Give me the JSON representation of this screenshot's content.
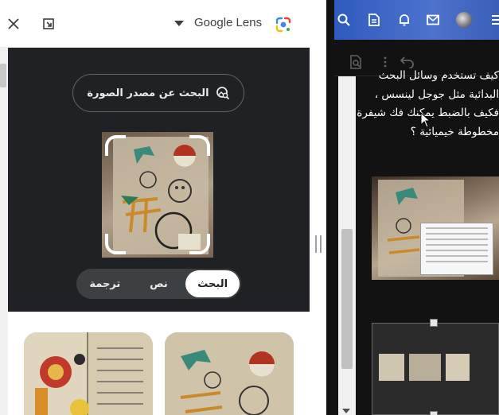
{
  "lens": {
    "title": "Google Lens",
    "source_button": "البحث عن مصدر الصورة",
    "tabs": [
      {
        "label": "البحث",
        "active": true
      },
      {
        "label": "نص",
        "active": false
      },
      {
        "label": "ترجمة",
        "active": false
      }
    ],
    "icons": {
      "close": "close-icon",
      "open_new": "open-in-new-icon",
      "menu": "caret-down-icon",
      "logo": "lens-logo-icon"
    },
    "accent_colors": {
      "blue": "#4285f4",
      "red": "#ea4335",
      "yellow": "#fbbc04",
      "green": "#34a853"
    }
  },
  "article": {
    "lines": [
      "كيف تستخدم وسائل البحث",
      "البدائية مثل جوجل لينسس ،",
      "فكيف بالضبط يمكنك فك شيفرة",
      "مخطوطة خيميائية ؟"
    ]
  },
  "blog_bar": {
    "icons": [
      "search-icon",
      "document-icon",
      "bell-icon",
      "mail-icon",
      "avatar",
      "menu-icon"
    ]
  }
}
